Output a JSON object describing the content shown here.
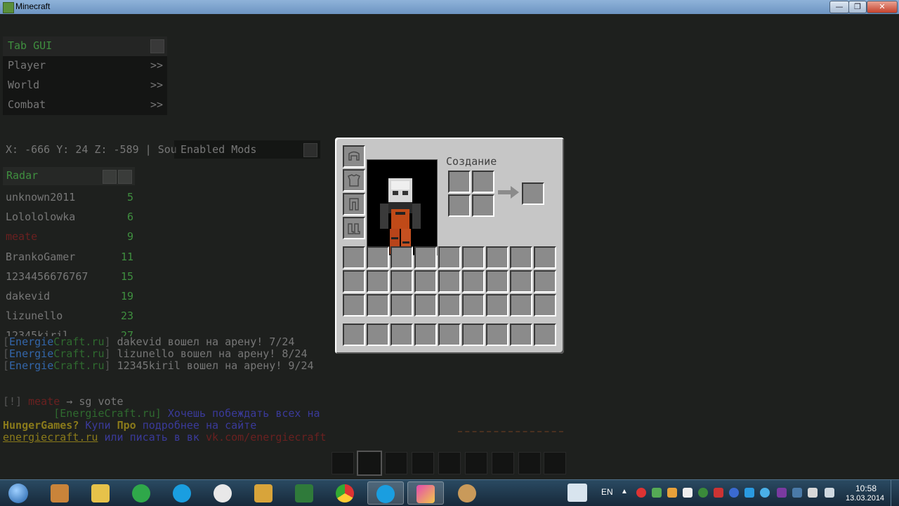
{
  "window": {
    "title": "Minecraft",
    "buttons": [
      "—",
      "❐",
      "✕"
    ]
  },
  "tab_gui": {
    "title": "Tab GUI",
    "items": [
      {
        "label": "Player",
        "arrow": ">>"
      },
      {
        "label": "World",
        "arrow": ">>"
      },
      {
        "label": "Combat",
        "arrow": ">>"
      }
    ]
  },
  "coords_text": "X: -666 Y: 24 Z: -589 | Sou",
  "enabled_mods": {
    "title": "Enabled Mods"
  },
  "radar": {
    "title": "Radar",
    "entries": [
      {
        "name": "unknown2011",
        "dist": "5"
      },
      {
        "name": "Lolololowka",
        "dist": "6"
      },
      {
        "name": "meate",
        "dist": "9"
      },
      {
        "name": "BrankoGamer",
        "dist": "11"
      },
      {
        "name": "1234456676767",
        "dist": "15"
      },
      {
        "name": "dakevid",
        "dist": "19"
      },
      {
        "name": "lizunello",
        "dist": "23"
      },
      {
        "name": "12345kiril",
        "dist": "27"
      }
    ]
  },
  "chat": {
    "bracket_open": "[",
    "bracket_close": "]",
    "server_a": "Energie",
    "server_b": "Craft.ru",
    "join_lines": [
      "dakevid вошел на арену! 7/24",
      "lizunello вошел на арену! 8/24",
      "12345kiril вошел на арену! 9/24"
    ],
    "pm_prefix": "[!]",
    "pm_name": "meate",
    "pm_text": "→ sg vote",
    "ad_server": "[EnergieCraft.ru]",
    "ad_text1": "Хочешь побеждать всех на",
    "ad_hg": "HungerGames?",
    "ad_buy": "Купи",
    "ad_pro": "Про",
    "ad_more": "подробнее на сайте",
    "ad_site": "energiecraft.ru",
    "ad_or": "или писать в вк",
    "ad_vk": "vk.com/energiecraft"
  },
  "inventory": {
    "crafting_title": "Создание"
  },
  "taskbar": {
    "language": "EN",
    "time": "10:58",
    "date": "13.03.2014"
  }
}
